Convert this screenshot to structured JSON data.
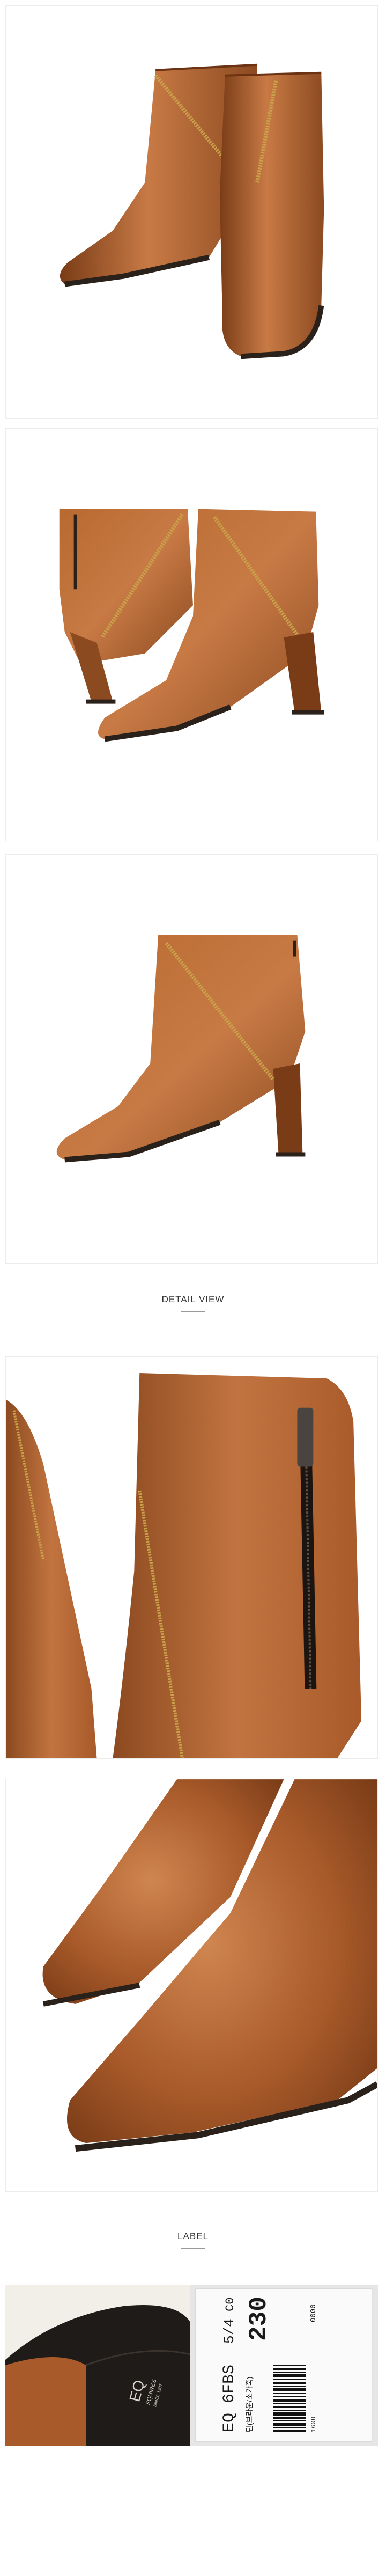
{
  "section_detail": {
    "title": "DETAIL VIEW"
  },
  "section_label": {
    "title": "LABEL"
  },
  "label_tag": {
    "model_code": "EQ 6FBS",
    "code_a": "5/4",
    "code_b": "C0",
    "size": "230",
    "color_note": "탄(브라운/소가죽)",
    "barcode_digits": "1608",
    "serial": "0000"
  },
  "brand_stamp": {
    "logo": "EQ",
    "name": "SQUIRES",
    "sub": "SINCE 1987"
  },
  "colors": {
    "leather": "#a85a2a",
    "leather_dark": "#7a3c17",
    "leather_light": "#c87a45",
    "zipper_gold": "#c9a24a",
    "sole": "#2b211b"
  }
}
